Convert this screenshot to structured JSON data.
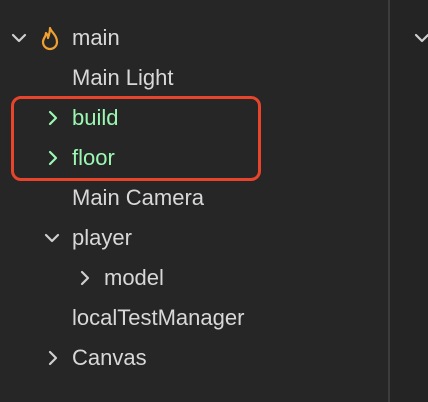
{
  "hierarchy": {
    "items": [
      {
        "label": "main",
        "icon": "scene-flame-icon",
        "expanded": true
      },
      {
        "label": "Main Light"
      },
      {
        "label": "build",
        "expanded": false,
        "highlighted": true
      },
      {
        "label": "floor",
        "expanded": false,
        "highlighted": true
      },
      {
        "label": "Main Camera"
      },
      {
        "label": "player",
        "expanded": true
      },
      {
        "label": "model",
        "expanded": false
      },
      {
        "label": "localTestManager"
      },
      {
        "label": "Canvas",
        "expanded": false
      }
    ]
  },
  "colors": {
    "background": "#262626",
    "text": "#d8d8d8",
    "highlight_text": "#9cf7b2",
    "annotation_box": "#e8442b",
    "scene_icon": "#f0a030"
  }
}
